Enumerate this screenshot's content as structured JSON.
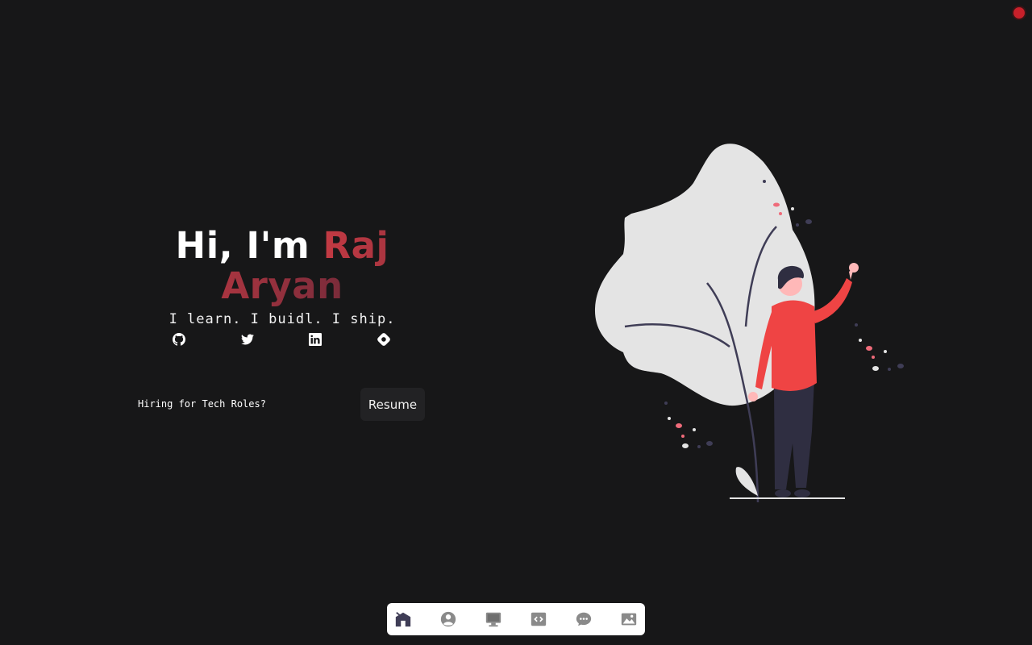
{
  "hero": {
    "greeting": "Hi, I'm ",
    "name": "Raj Aryan",
    "tagline": "I learn. I buidl. I ship."
  },
  "socials": [
    {
      "icon": "github-icon"
    },
    {
      "icon": "twitter-icon"
    },
    {
      "icon": "linkedin-icon"
    },
    {
      "icon": "hashnode-icon"
    }
  ],
  "hiring": {
    "text": "Hiring for Tech Roles?",
    "resume_label": "Resume"
  },
  "dock": {
    "items": [
      "home-icon",
      "about-icon",
      "projects-icon",
      "code-icon",
      "contact-icon",
      "gallery-icon"
    ]
  },
  "colors": {
    "background": "#171718",
    "accent": "#c33a43",
    "accent_dark": "#7a2b3a",
    "illustration_red": "#ef4444"
  }
}
